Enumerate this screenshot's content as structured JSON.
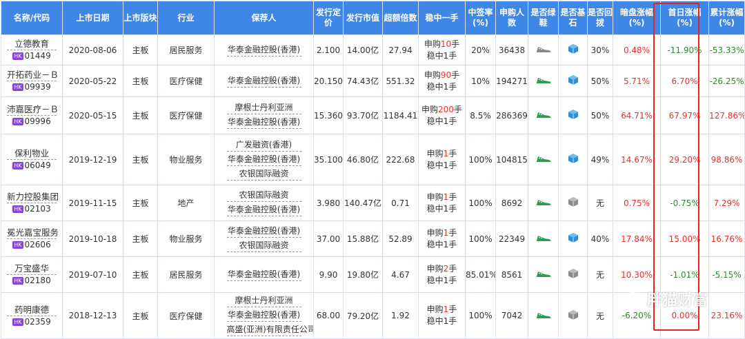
{
  "headers": [
    {
      "key": "name",
      "label": "名称/代码"
    },
    {
      "key": "date",
      "label": "上市日期"
    },
    {
      "key": "board",
      "label": "上市版块"
    },
    {
      "key": "industry",
      "label": "行业"
    },
    {
      "key": "sponsor",
      "label": "保荐人"
    },
    {
      "key": "price",
      "label": "发行定价"
    },
    {
      "key": "mktcap",
      "label": "发行市值"
    },
    {
      "key": "oversub",
      "label": "超额倍数"
    },
    {
      "key": "lot",
      "label": "稳中一手"
    },
    {
      "key": "winrate",
      "label": "中签率(%)"
    },
    {
      "key": "applicants",
      "label": "申购人数"
    },
    {
      "key": "greenshoe",
      "label": "是否绿鞋"
    },
    {
      "key": "cornerstone",
      "label": "是否基石"
    },
    {
      "key": "clawback",
      "label": "是否回拨"
    },
    {
      "key": "grey",
      "label": "暗盘涨幅(%)"
    },
    {
      "key": "firstday",
      "label": "首日涨幅(%)"
    },
    {
      "key": "cumulative",
      "label": "累计涨幅(%)"
    }
  ],
  "market_badge": "HK",
  "rows": [
    {
      "name": "立德教育",
      "code": "01449",
      "date": "2020-08-06",
      "board": "主板",
      "industry": "居民服务",
      "sponsors": [
        "华泰金融控股(香港)"
      ],
      "price": "2.100",
      "mktcap": "14.00亿",
      "oversub": "27.94",
      "lot_prefix": "申购",
      "lot_num": "10",
      "lot_suffix": "手",
      "lot_line2": "稳中1手",
      "winrate": "20%",
      "applicants": "36438",
      "greenshoe": "shoe-gray-icon",
      "cornerstone": "cube-blue-icon",
      "clawback": "30%",
      "grey": "0.48%",
      "grey_color": "red",
      "firstday": "-11.90%",
      "firstday_color": "green",
      "cumulative": "-53.33%",
      "cumulative_color": "green"
    },
    {
      "name": "开拓药业－Ｂ",
      "code": "09939",
      "date": "2020-05-22",
      "board": "主板",
      "industry": "医疗保健",
      "sponsors": [
        "华泰金融控股(香港)"
      ],
      "price": "20.150",
      "mktcap": "74.43亿",
      "oversub": "551.32",
      "lot_prefix": "申购",
      "lot_num": "90",
      "lot_suffix": "手",
      "lot_line2": "稳中1手",
      "winrate": "10%",
      "applicants": "194271",
      "greenshoe": "shoe-green-icon",
      "cornerstone": "cube-blue-icon",
      "clawback": "50%",
      "grey": "5.71%",
      "grey_color": "red",
      "firstday": "6.70%",
      "firstday_color": "red",
      "cumulative": "-26.25%",
      "cumulative_color": "green"
    },
    {
      "name": "沛嘉医疗－Ｂ",
      "code": "09996",
      "date": "2020-05-15",
      "board": "主板",
      "industry": "医疗保健",
      "sponsors": [
        "摩根士丹利亚洲",
        "华泰金融控股(香港)"
      ],
      "price": "15.360",
      "mktcap": "93.70亿",
      "oversub": "1184.41",
      "lot_prefix": "申购",
      "lot_num": "200",
      "lot_suffix": "手",
      "lot_line2": "稳中1手",
      "winrate": "8.5%",
      "applicants": "286369",
      "greenshoe": "shoe-green-icon",
      "cornerstone": "cube-blue-icon",
      "clawback": "50%",
      "grey": "64.71%",
      "grey_color": "red",
      "firstday": "67.97%",
      "firstday_color": "red",
      "cumulative": "127.86%",
      "cumulative_color": "red"
    },
    {
      "name": "保利物业",
      "code": "06049",
      "date": "2019-12-19",
      "board": "主板",
      "industry": "物业服务",
      "sponsors": [
        "广发融资(香港)",
        "华泰金融控股(香港)",
        "农银国际融资"
      ],
      "price": "35.100",
      "mktcap": "46.80亿",
      "oversub": "222.68",
      "lot_prefix": "申购",
      "lot_num": "1",
      "lot_suffix": "手",
      "lot_line2": "稳中1手",
      "winrate": "100%",
      "applicants": "104815",
      "greenshoe": "shoe-green-icon",
      "cornerstone": "cube-blue-icon",
      "clawback": "49%",
      "grey": "14.67%",
      "grey_color": "red",
      "firstday": "29.20%",
      "firstday_color": "red",
      "cumulative": "98.86%",
      "cumulative_color": "red"
    },
    {
      "name": "新力控股集团",
      "code": "02103",
      "date": "2019-11-15",
      "board": "主板",
      "industry": "地产",
      "sponsors": [
        "农银国际融资",
        "华泰金融控股(香港)"
      ],
      "price": "3.980",
      "mktcap": "140.47亿",
      "oversub": "0.71",
      "lot_prefix": "申购",
      "lot_num": "1",
      "lot_suffix": "手",
      "lot_line2": "稳中1手",
      "winrate": "100%",
      "applicants": "8692",
      "greenshoe": "shoe-green-icon",
      "cornerstone": "cube-gray-icon",
      "clawback": "无",
      "grey": "0.75%",
      "grey_color": "red",
      "firstday": "-0.75%",
      "firstday_color": "green",
      "cumulative": "7.29%",
      "cumulative_color": "red"
    },
    {
      "name": "冕光嘉宝服务",
      "code": "02606",
      "date": "2019-10-18",
      "board": "主板",
      "industry": "物业服务",
      "sponsors": [
        "华泰金融控股(香港)",
        "农银国际融资"
      ],
      "price": "37.00",
      "mktcap": "15.88亿",
      "oversub": "52.89",
      "lot_prefix": "申购",
      "lot_num": "1",
      "lot_suffix": "手",
      "lot_line2": "稳中1手",
      "winrate": "100%",
      "applicants": "22349",
      "greenshoe": "shoe-green-icon",
      "cornerstone": "cube-blue-icon",
      "clawback": "40%",
      "grey": "17.84%",
      "grey_color": "red",
      "firstday": "15.00%",
      "firstday_color": "red",
      "cumulative": "16.76%",
      "cumulative_color": "red"
    },
    {
      "name": "万宝盛华",
      "code": "02180",
      "date": "2019-07-10",
      "board": "主板",
      "industry": "居民服务",
      "sponsors": [
        "华泰金融控股(香港)"
      ],
      "price": "9.90",
      "mktcap": "19.80亿",
      "oversub": "4.67",
      "lot_prefix": "申购",
      "lot_num": "2",
      "lot_suffix": "手",
      "lot_line2": "稳中1手",
      "winrate": "85.01%",
      "applicants": "8561",
      "greenshoe": "shoe-green-icon",
      "cornerstone": "cube-gray-icon",
      "clawback": "无",
      "grey": "10.30%",
      "grey_color": "red",
      "firstday": "-1.01%",
      "firstday_color": "green",
      "cumulative": "-5.15%",
      "cumulative_color": "green"
    },
    {
      "name": "药明康德",
      "code": "02359",
      "date": "2018-12-13",
      "board": "主板",
      "industry": "医疗保健",
      "sponsors": [
        "摩根士丹利亚洲",
        "华泰金融控股(香港)",
        "高盛(亚洲)有限责任公司"
      ],
      "price": "68.00",
      "mktcap": "79.20亿",
      "oversub": "1.92",
      "lot_prefix": "申购",
      "lot_num": "1",
      "lot_suffix": "手",
      "lot_line2": "稳中1手",
      "winrate": "100%",
      "applicants": "7042",
      "greenshoe": "shoe-green-icon",
      "cornerstone": "cube-gray-icon",
      "clawback": "无",
      "grey": "-6.20%",
      "grey_color": "green",
      "firstday": "0.00%",
      "firstday_color": "red",
      "cumulative": "23.16%",
      "cumulative_color": "red"
    }
  ],
  "watermark": "胖猫财富",
  "colors": {
    "header_bg": "#3e87e6",
    "red": "#e8302e",
    "green": "#2a8c2a",
    "highlight_box": "#e52323",
    "hk_badge": "#8a44d4"
  }
}
